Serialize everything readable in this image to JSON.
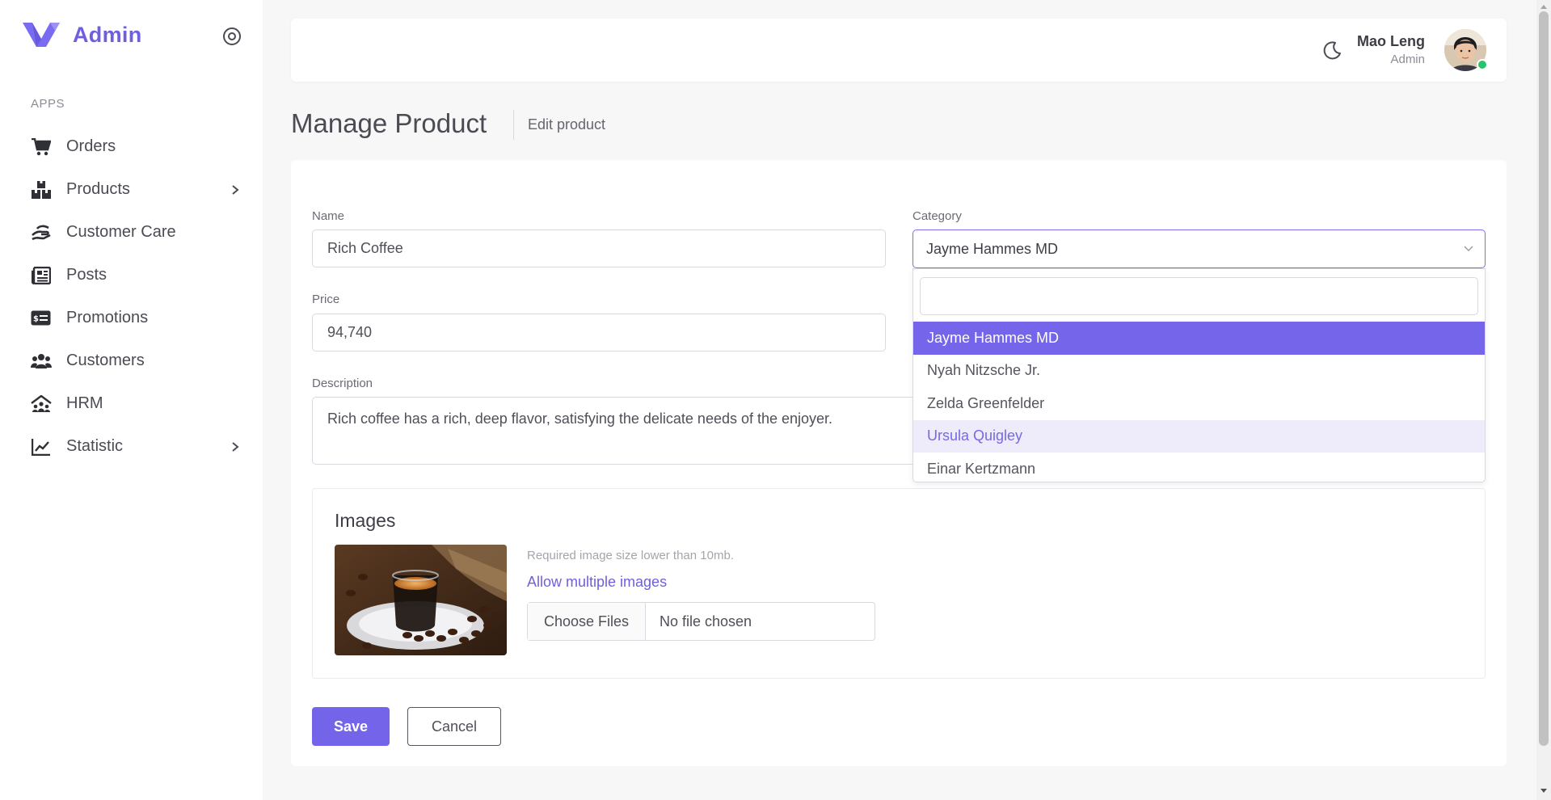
{
  "brand": {
    "name": "Admin",
    "logo_icon": "v-logo-icon",
    "accent": "#6e5fe0"
  },
  "sidebar": {
    "section_title": "APPS",
    "items": [
      {
        "label": "Orders",
        "icon": "cart-icon",
        "has_submenu": false
      },
      {
        "label": "Products",
        "icon": "boxes-icon",
        "has_submenu": true
      },
      {
        "label": "Customer Care",
        "icon": "hand-care-icon",
        "has_submenu": false
      },
      {
        "label": "Posts",
        "icon": "newspaper-icon",
        "has_submenu": false
      },
      {
        "label": "Promotions",
        "icon": "money-ticket-icon",
        "has_submenu": false
      },
      {
        "label": "Customers",
        "icon": "users-icon",
        "has_submenu": false
      },
      {
        "label": "HRM",
        "icon": "team-roof-icon",
        "has_submenu": false
      },
      {
        "label": "Statistic",
        "icon": "line-chart-icon",
        "has_submenu": true
      }
    ]
  },
  "topbar": {
    "user_name": "Mao Leng",
    "user_role": "Admin",
    "status": "online",
    "status_color": "#27c46b"
  },
  "page": {
    "title": "Manage Product",
    "subtitle": "Edit product"
  },
  "form": {
    "name_label": "Name",
    "name_value": "Rich Coffee",
    "price_label": "Price",
    "price_value": "94,740",
    "description_label": "Description",
    "description_value": "Rich coffee has a rich, deep flavor, satisfying the delicate needs of the enjoyer.",
    "category_label": "Category",
    "category_value": "Jayme Hammes MD",
    "category_search_value": "",
    "category_options": [
      "Jayme Hammes MD",
      "Nyah Nitzsche Jr.",
      "Zelda Greenfelder",
      "Ursula Quigley",
      "Einar Kertzmann"
    ],
    "category_selected_index": 0,
    "category_hover_index": 3
  },
  "images": {
    "title": "Images",
    "hint": "Required image size lower than 10mb.",
    "multi_link": "Allow multiple images",
    "choose_button": "Choose Files",
    "file_status": "No file chosen"
  },
  "actions": {
    "save_label": "Save",
    "cancel_label": "Cancel"
  }
}
